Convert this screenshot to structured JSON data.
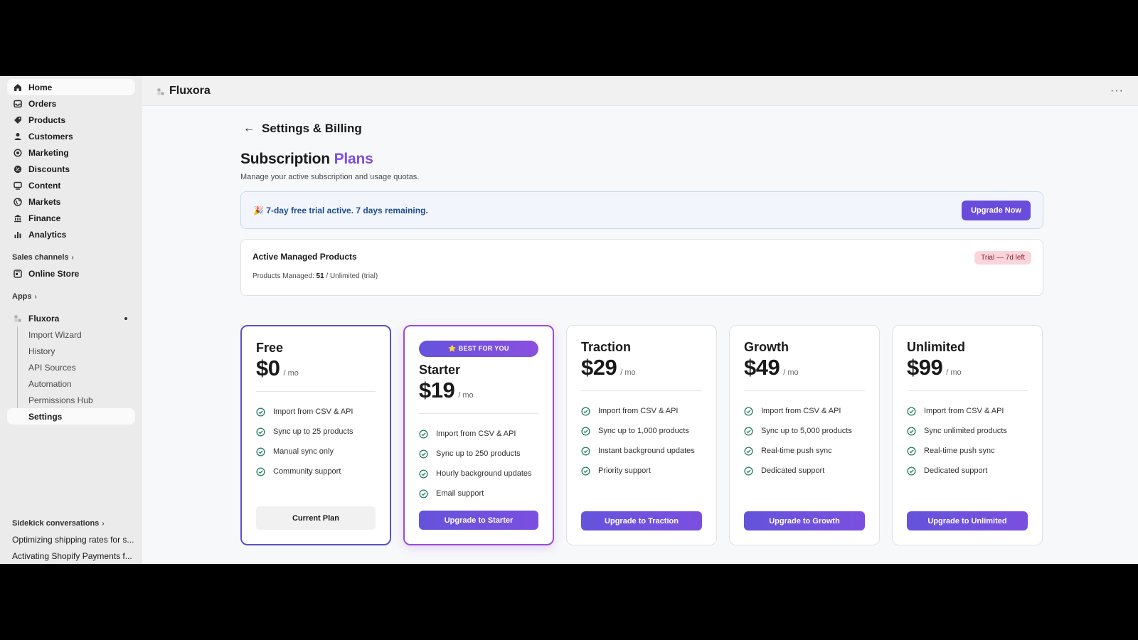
{
  "sidebar": {
    "nav": [
      {
        "label": "Home",
        "icon": "home-icon"
      },
      {
        "label": "Orders",
        "icon": "orders-icon"
      },
      {
        "label": "Products",
        "icon": "tag-icon"
      },
      {
        "label": "Customers",
        "icon": "person-icon"
      },
      {
        "label": "Marketing",
        "icon": "target-icon"
      },
      {
        "label": "Discounts",
        "icon": "discount-icon"
      },
      {
        "label": "Content",
        "icon": "content-icon"
      },
      {
        "label": "Markets",
        "icon": "globe-icon"
      },
      {
        "label": "Finance",
        "icon": "bank-icon"
      },
      {
        "label": "Analytics",
        "icon": "bar-chart-icon"
      }
    ],
    "sales_channels_label": "Sales channels",
    "online_store": "Online Store",
    "apps_label": "Apps",
    "app_name": "Fluxora",
    "app_sub": [
      "Import Wizard",
      "History",
      "API Sources",
      "Automation",
      "Permissions Hub",
      "Settings"
    ],
    "sidekick_label": "Sidekick conversations",
    "conversations": [
      "Optimizing shipping rates for s...",
      "Activating Shopify Payments f..."
    ]
  },
  "topbar": {
    "app_name": "Fluxora",
    "more": "···"
  },
  "page": {
    "back_title": "Settings & Billing",
    "heading_main": "Subscription ",
    "heading_accent": "Plans",
    "subtitle": "Manage your active subscription and usage quotas.",
    "trial_emoji": "🎉",
    "trial_message": "7-day free trial active. 7 days remaining.",
    "upgrade_now": "Upgrade Now",
    "active_title": "Active Managed Products",
    "active_prefix": "Products Managed: ",
    "active_count": "51",
    "active_suffix": " / Unlimited (trial)",
    "trial_badge": "Trial — 7d left"
  },
  "plans": [
    {
      "name": "Free",
      "amount": "$0",
      "per": "/ mo",
      "features": [
        "Import from CSV & API",
        "Sync up to 25 products",
        "Manual sync only",
        "Community support"
      ],
      "cta": "Current Plan"
    },
    {
      "badge": "⭐ BEST FOR YOU",
      "name": "Starter",
      "amount": "$19",
      "per": "/ mo",
      "features": [
        "Import from CSV & API",
        "Sync up to 250 products",
        "Hourly background updates",
        "Email support"
      ],
      "cta": "Upgrade to Starter"
    },
    {
      "name": "Traction",
      "amount": "$29",
      "per": "/ mo",
      "features": [
        "Import from CSV & API",
        "Sync up to 1,000 products",
        "Instant background updates",
        "Priority support"
      ],
      "cta": "Upgrade to Traction"
    },
    {
      "name": "Growth",
      "amount": "$49",
      "per": "/ mo",
      "features": [
        "Import from CSV & API",
        "Sync up to 5,000 products",
        "Real-time push sync",
        "Dedicated support"
      ],
      "cta": "Upgrade to Growth"
    },
    {
      "name": "Unlimited",
      "amount": "$99",
      "per": "/ mo",
      "features": [
        "Import from CSV & API",
        "Sync unlimited products",
        "Real-time push sync",
        "Dedicated support"
      ],
      "cta": "Upgrade to Unlimited"
    }
  ],
  "colors": {
    "accent": "#6a4cdc",
    "check": "#1f7a5a",
    "trial_text": "#1e4d8f"
  }
}
